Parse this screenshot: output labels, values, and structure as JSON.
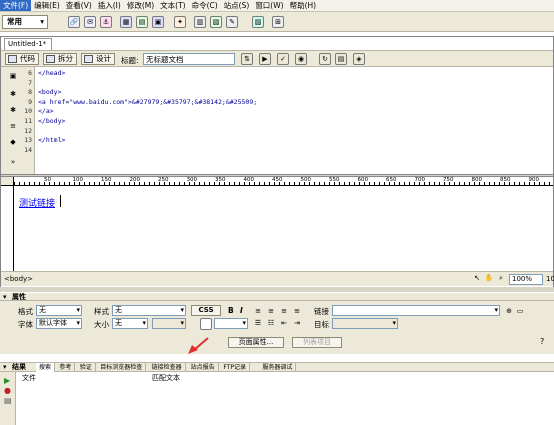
{
  "menu": [
    "文件(F)",
    "编辑(E)",
    "查看(V)",
    "插入(I)",
    "修改(M)",
    "文本(T)",
    "命令(C)",
    "站点(S)",
    "窗口(W)",
    "帮助(H)"
  ],
  "insert_bar": {
    "category": "常用"
  },
  "document": {
    "tab": "Untitled-1*",
    "view_buttons": {
      "code": "代码",
      "split": "拆分",
      "design": "设计"
    },
    "title_label": "标题:",
    "title_value": "无标题文档"
  },
  "code_view": {
    "line_numbers": [
      "6",
      "7",
      "8",
      "9",
      "10",
      "11",
      "12",
      "13",
      "14"
    ],
    "lines": [
      "</head>",
      "",
      "<body>",
      "<a href=\"www.baidu.com\">&#27979;&#35797;&#38142;&#25509;",
      "</a>",
      "</body>",
      "",
      "</html>",
      ""
    ]
  },
  "ruler_ticks": [
    "50",
    "100",
    "150",
    "200",
    "250",
    "300",
    "350",
    "400",
    "450",
    "500",
    "550",
    "600",
    "650",
    "700",
    "750",
    "800",
    "850",
    "900",
    "950"
  ],
  "design_view": {
    "link_text": "测试链接"
  },
  "status_bar": {
    "tag": "<body>",
    "zoom": "100%",
    "size": "10"
  },
  "properties": {
    "header": "属性",
    "format_label": "格式",
    "format_value": "无",
    "style_label": "样式",
    "style_value": "无",
    "css_button": "CSS",
    "bold": "B",
    "italic": "I",
    "link_label": "链接",
    "font_label": "字体",
    "font_value": "默认字体",
    "size_label": "大小",
    "size_value": "无",
    "target_label": "目标",
    "page_props_button": "页面属性...",
    "list_item_button": "列表项目"
  },
  "results": {
    "header": "结果",
    "tabs": [
      "搜索",
      "参考",
      "验证",
      "目标浏览器检查",
      "链接检查器",
      "站点报告",
      "FTP记录",
      "服务器调试"
    ],
    "columns": [
      "文件",
      "匹配文本"
    ]
  },
  "colors": {
    "accent": "#316ac5",
    "link": "#0000ff",
    "tag": "#000099",
    "arrow": "#e03030"
  }
}
